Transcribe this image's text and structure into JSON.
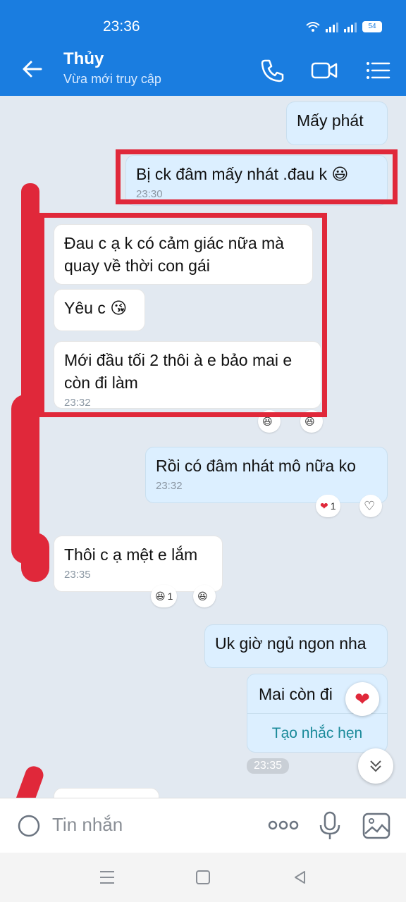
{
  "status": {
    "time": "23:36",
    "battery": "54"
  },
  "header": {
    "name": "Thủy",
    "subtitle": "Vừa mới truy cập"
  },
  "messages": [
    {
      "text": "Mấy phát"
    },
    {
      "text": "Bị ck đâm mấy nhát .đau k",
      "emoji": "😃",
      "time": "23:30"
    },
    {
      "text": "Đau c ạ k có cảm giác nữa mà quay về thời con gái"
    },
    {
      "text": "Yêu c",
      "emoji": "😘"
    },
    {
      "text": "Mới đầu tối 2 thôi à e bảo mai e còn đi làm",
      "time": "23:32"
    },
    {
      "text": "Rồi có đâm nhát mô nữa ko",
      "time": "23:32"
    },
    {
      "text": "Thôi c ạ mệt e lắm",
      "time": "23:35"
    },
    {
      "text": "Uk giờ ngủ ngon nha"
    },
    {
      "text": "Mai còn đi",
      "action": "Tạo nhắc hẹn"
    }
  ],
  "reactions": {
    "r1_count": "1",
    "r2_count": "1",
    "r3_count": "1"
  },
  "time_pill": "23:35",
  "input": {
    "placeholder": "Tin nhắn"
  },
  "icons": {
    "back": "arrow-left-icon",
    "call": "phone-icon",
    "video": "video-camera-icon",
    "menu": "list-menu-icon",
    "more": "more-dots-icon",
    "mic": "microphone-icon",
    "image": "image-icon",
    "scroll": "double-chevron-down-icon"
  },
  "colors": {
    "accent": "#1a7de0",
    "highlight": "#e0283a",
    "outgoing": "#dcefff"
  }
}
